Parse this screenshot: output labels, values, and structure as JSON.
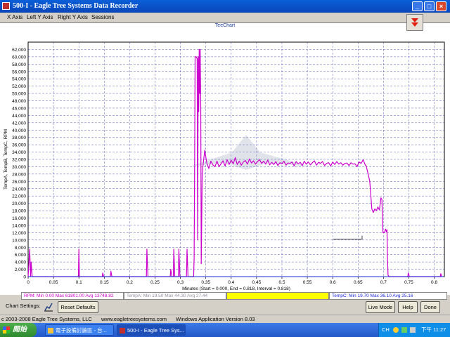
{
  "window": {
    "title": "500-I - Eagle Tree Systems Data Recorder"
  },
  "menu": [
    "X Axis",
    "Left Y Axis",
    "Right Y Axis",
    "Sessions"
  ],
  "chart_data": {
    "type": "line",
    "title": "TeeChart",
    "xlabel": "Minutes (Start = 0.000, End = 0.818, Interval = 0.818)",
    "ylabel": "TempA, TempB, TempC, RPM",
    "xlim": [
      0,
      0.82
    ],
    "ylim": [
      0,
      64000
    ],
    "x_ticks": [
      0,
      0.05,
      0.1,
      0.15,
      0.2,
      0.25,
      0.3,
      0.35,
      0.4,
      0.45,
      0.5,
      0.55,
      0.6,
      0.65,
      0.7,
      0.75,
      0.8
    ],
    "x_tick_labels": [
      "0",
      "0.05",
      "0.1",
      "0.15",
      "0.2",
      "0.25",
      "0.3",
      "0.35",
      "0.4",
      "0.45",
      "0.5",
      "0.55",
      "0.6",
      "0.65",
      "0.7",
      "0.75",
      "0.8"
    ],
    "y_ticks": [
      0,
      2000,
      4000,
      6000,
      8000,
      10000,
      12000,
      14000,
      16000,
      18000,
      20000,
      22000,
      24000,
      26000,
      28000,
      30000,
      32000,
      34000,
      36000,
      38000,
      40000,
      42000,
      44000,
      46000,
      48000,
      50000,
      52000,
      54000,
      56000,
      58000,
      60000,
      62000
    ],
    "y_tick_labels": [
      "0",
      "2,000",
      "4,000",
      "6,000",
      "8,000",
      "10,000",
      "12,000",
      "14,000",
      "16,000",
      "18,000",
      "20,000",
      "22,000",
      "24,000",
      "26,000",
      "28,000",
      "30,000",
      "32,000",
      "34,000",
      "36,000",
      "38,000",
      "40,000",
      "42,000",
      "44,000",
      "46,000",
      "48,000",
      "50,000",
      "52,000",
      "54,000",
      "56,000",
      "58,000",
      "60,000",
      "62,000"
    ],
    "grid": true,
    "series": [
      {
        "name": "RPM",
        "color": "#cc00cc",
        "points": [
          [
            0.0,
            0
          ],
          [
            0.003,
            7500
          ],
          [
            0.005,
            0
          ],
          [
            0.006,
            4000
          ],
          [
            0.008,
            0
          ],
          [
            0.099,
            0
          ],
          [
            0.1,
            7500
          ],
          [
            0.101,
            0
          ],
          [
            0.146,
            0
          ],
          [
            0.147,
            1000
          ],
          [
            0.149,
            0
          ],
          [
            0.162,
            0
          ],
          [
            0.163,
            1500
          ],
          [
            0.165,
            0
          ],
          [
            0.233,
            0
          ],
          [
            0.234,
            7500
          ],
          [
            0.236,
            0
          ],
          [
            0.28,
            0
          ],
          [
            0.281,
            2000
          ],
          [
            0.283,
            0
          ],
          [
            0.286,
            0
          ],
          [
            0.287,
            7500
          ],
          [
            0.289,
            0
          ],
          [
            0.296,
            0
          ],
          [
            0.297,
            7500
          ],
          [
            0.299,
            0
          ],
          [
            0.312,
            0
          ],
          [
            0.313,
            7500
          ],
          [
            0.315,
            0
          ],
          [
            0.326,
            0
          ],
          [
            0.327,
            5000
          ],
          [
            0.328,
            30000
          ],
          [
            0.329,
            60000
          ],
          [
            0.331,
            60000
          ],
          [
            0.333,
            59500
          ],
          [
            0.334,
            10000
          ],
          [
            0.335,
            60000
          ],
          [
            0.336,
            45000
          ],
          [
            0.337,
            62000
          ],
          [
            0.338,
            50000
          ],
          [
            0.339,
            62000
          ],
          [
            0.34,
            47000
          ],
          [
            0.341,
            3500
          ],
          [
            0.343,
            28000
          ],
          [
            0.345,
            31000
          ],
          [
            0.348,
            34500
          ],
          [
            0.352,
            31000
          ],
          [
            0.356,
            29500
          ],
          [
            0.36,
            31500
          ],
          [
            0.364,
            30500
          ],
          [
            0.368,
            30000
          ],
          [
            0.372,
            31500
          ],
          [
            0.376,
            30000
          ],
          [
            0.38,
            30800
          ],
          [
            0.384,
            31600
          ],
          [
            0.388,
            30200
          ],
          [
            0.392,
            31900
          ],
          [
            0.396,
            30600
          ],
          [
            0.4,
            31800
          ],
          [
            0.404,
            30800
          ],
          [
            0.408,
            32500
          ],
          [
            0.412,
            30600
          ],
          [
            0.416,
            31500
          ],
          [
            0.42,
            30400
          ],
          [
            0.424,
            31300
          ],
          [
            0.428,
            31700
          ],
          [
            0.432,
            30700
          ],
          [
            0.436,
            32100
          ],
          [
            0.44,
            31000
          ],
          [
            0.444,
            31600
          ],
          [
            0.448,
            30700
          ],
          [
            0.452,
            31400
          ],
          [
            0.456,
            31900
          ],
          [
            0.46,
            30900
          ],
          [
            0.464,
            31500
          ],
          [
            0.468,
            30700
          ],
          [
            0.472,
            31800
          ],
          [
            0.476,
            30500
          ],
          [
            0.48,
            31200
          ],
          [
            0.484,
            30600
          ],
          [
            0.488,
            31400
          ],
          [
            0.492,
            30300
          ],
          [
            0.496,
            31100
          ],
          [
            0.5,
            30800
          ],
          [
            0.504,
            31500
          ],
          [
            0.508,
            30400
          ],
          [
            0.512,
            31000
          ],
          [
            0.516,
            30900
          ],
          [
            0.52,
            31300
          ],
          [
            0.524,
            30200
          ],
          [
            0.528,
            31400
          ],
          [
            0.532,
            30800
          ],
          [
            0.536,
            31200
          ],
          [
            0.54,
            30300
          ],
          [
            0.544,
            31500
          ],
          [
            0.548,
            30700
          ],
          [
            0.552,
            31300
          ],
          [
            0.556,
            30500
          ],
          [
            0.56,
            31100
          ],
          [
            0.564,
            31600
          ],
          [
            0.568,
            30400
          ],
          [
            0.572,
            31200
          ],
          [
            0.576,
            30900
          ],
          [
            0.58,
            31400
          ],
          [
            0.584,
            30300
          ],
          [
            0.588,
            30900
          ],
          [
            0.592,
            31100
          ],
          [
            0.596,
            30200
          ],
          [
            0.6,
            31300
          ],
          [
            0.604,
            30600
          ],
          [
            0.608,
            31400
          ],
          [
            0.612,
            30700
          ],
          [
            0.616,
            31100
          ],
          [
            0.62,
            30400
          ],
          [
            0.624,
            30900
          ],
          [
            0.628,
            31000
          ],
          [
            0.632,
            30300
          ],
          [
            0.636,
            31100
          ],
          [
            0.64,
            30700
          ],
          [
            0.644,
            30800
          ],
          [
            0.648,
            30000
          ],
          [
            0.652,
            31300
          ],
          [
            0.656,
            30900
          ],
          [
            0.66,
            31900
          ],
          [
            0.664,
            30500
          ],
          [
            0.666,
            30200
          ],
          [
            0.669,
            28500
          ],
          [
            0.673,
            26000
          ],
          [
            0.677,
            18500
          ],
          [
            0.68,
            17500
          ],
          [
            0.683,
            18500
          ],
          [
            0.686,
            18000
          ],
          [
            0.689,
            19000
          ],
          [
            0.692,
            18200
          ],
          [
            0.695,
            21500
          ],
          [
            0.697,
            21000
          ],
          [
            0.699,
            12000
          ],
          [
            0.702,
            12000
          ],
          [
            0.704,
            13000
          ],
          [
            0.706,
            12200
          ],
          [
            0.707,
            12800
          ],
          [
            0.708,
            5000
          ],
          [
            0.709,
            400
          ],
          [
            0.711,
            0
          ],
          [
            0.748,
            0
          ],
          [
            0.749,
            1000
          ],
          [
            0.751,
            0
          ],
          [
            0.8,
            0
          ],
          [
            0.812,
            0
          ],
          [
            0.813,
            800
          ],
          [
            0.815,
            0
          ]
        ]
      },
      {
        "name": "TempC",
        "color": "#1a2ad8",
        "points": [
          [
            0.0,
            0
          ],
          [
            0.818,
            0
          ]
        ]
      },
      {
        "name": "Marker",
        "color": "#444444",
        "points": [
          [
            0.6,
            10200
          ],
          [
            0.658,
            10200
          ],
          [
            0.658,
            11200
          ]
        ]
      }
    ]
  },
  "stats": [
    {
      "text": "RPM:  Min 0.00    Max 61801.00    Avg 13748.82",
      "color": "#cc00cc",
      "bg": "#ffffff"
    },
    {
      "text": "TempA:  Min 19.50    Max 44.30    Avg 27.44",
      "color": "#9090a0",
      "bg": "#ffffff"
    },
    {
      "text": "",
      "color": "#000000",
      "bg": "#ffff00"
    },
    {
      "text": "TempC:  Min 19.70    Max 36.10    Avg 25.16",
      "color": "#1a2ad8",
      "bg": "#ffffff"
    }
  ],
  "settings": {
    "label": "Chart Settings:",
    "reset_label": "Reset Defaults",
    "live_label": "Live Mode",
    "help_label": "Help",
    "done_label": "Done"
  },
  "status": {
    "copyright": "c 2003-2008 Eagle Tree Systems, LLC",
    "url": "www.eagletreesystems.com",
    "version": "Windows Application Version 8.03"
  },
  "taskbar": {
    "start_label": "開始",
    "tasks": [
      "電子設備討論區 - 台...",
      "500-I - Eagle Tree Sys..."
    ],
    "tray_lang": "CH",
    "clock": "下午 11:27"
  },
  "colors": {
    "grid": "#2020a0",
    "accent": "#0a46b8",
    "plot_bg": "#ffffff"
  }
}
